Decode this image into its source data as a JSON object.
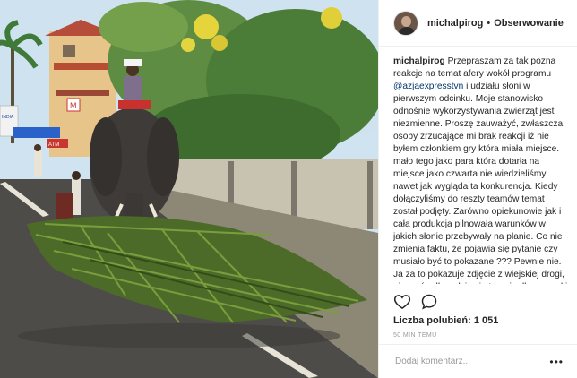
{
  "post": {
    "username": "michalpirog",
    "separator": "•",
    "follow_label": "Obserwowanie",
    "caption_user": "michalpirog",
    "caption_pre": " Przepraszam za tak pozna reakcje na temat afery wokół programu ",
    "caption_mention": "@azjaexpresstvn",
    "caption_post": " i udziału słoni w pierwszym odcinku. Moje stanowisko odnośnie wykorzystywania zwierząt jest niezmienne. Proszę zauważyć, zwłaszcza osoby zrzucające mi brak reakcji iż nie byłem członkiem gry która miała miejsce. mało tego jako para która dotarła na miejsce jako czwarta nie wiedzieliśmy nawet jak wygląda ta konkurencja. Kiedy dołączyliśmy do reszty teamów temat został podjęty. Zarówno opiekunowie jak i cała produkcja pilnowała warunków w jakich słonie przebywały na planie. Co nie zmienia faktu, że pojawia się pytanie czy musiało być to pokazane ??? Pewnie nie. Ja za to pokazuje zdjęcie z wiejskiej drogi, nie z ośrodka gdzie się trenuje dla rozrywki białych jak zarzucają niektórzy. Tak słoń w",
    "likes_label": "Liczba polubień: 1 051",
    "time_label": "50 MIN TEMU",
    "comment_placeholder": "Dodaj komentarz...",
    "more_label": "•••"
  },
  "photo": {
    "sign_left": "INDIA",
    "sign_shop": "ATM",
    "sign_right": "M"
  },
  "icons": {
    "avatar": "profile-avatar",
    "like": "heart-icon",
    "comment": "comment-bubble-icon",
    "more": "more-options-icon"
  }
}
